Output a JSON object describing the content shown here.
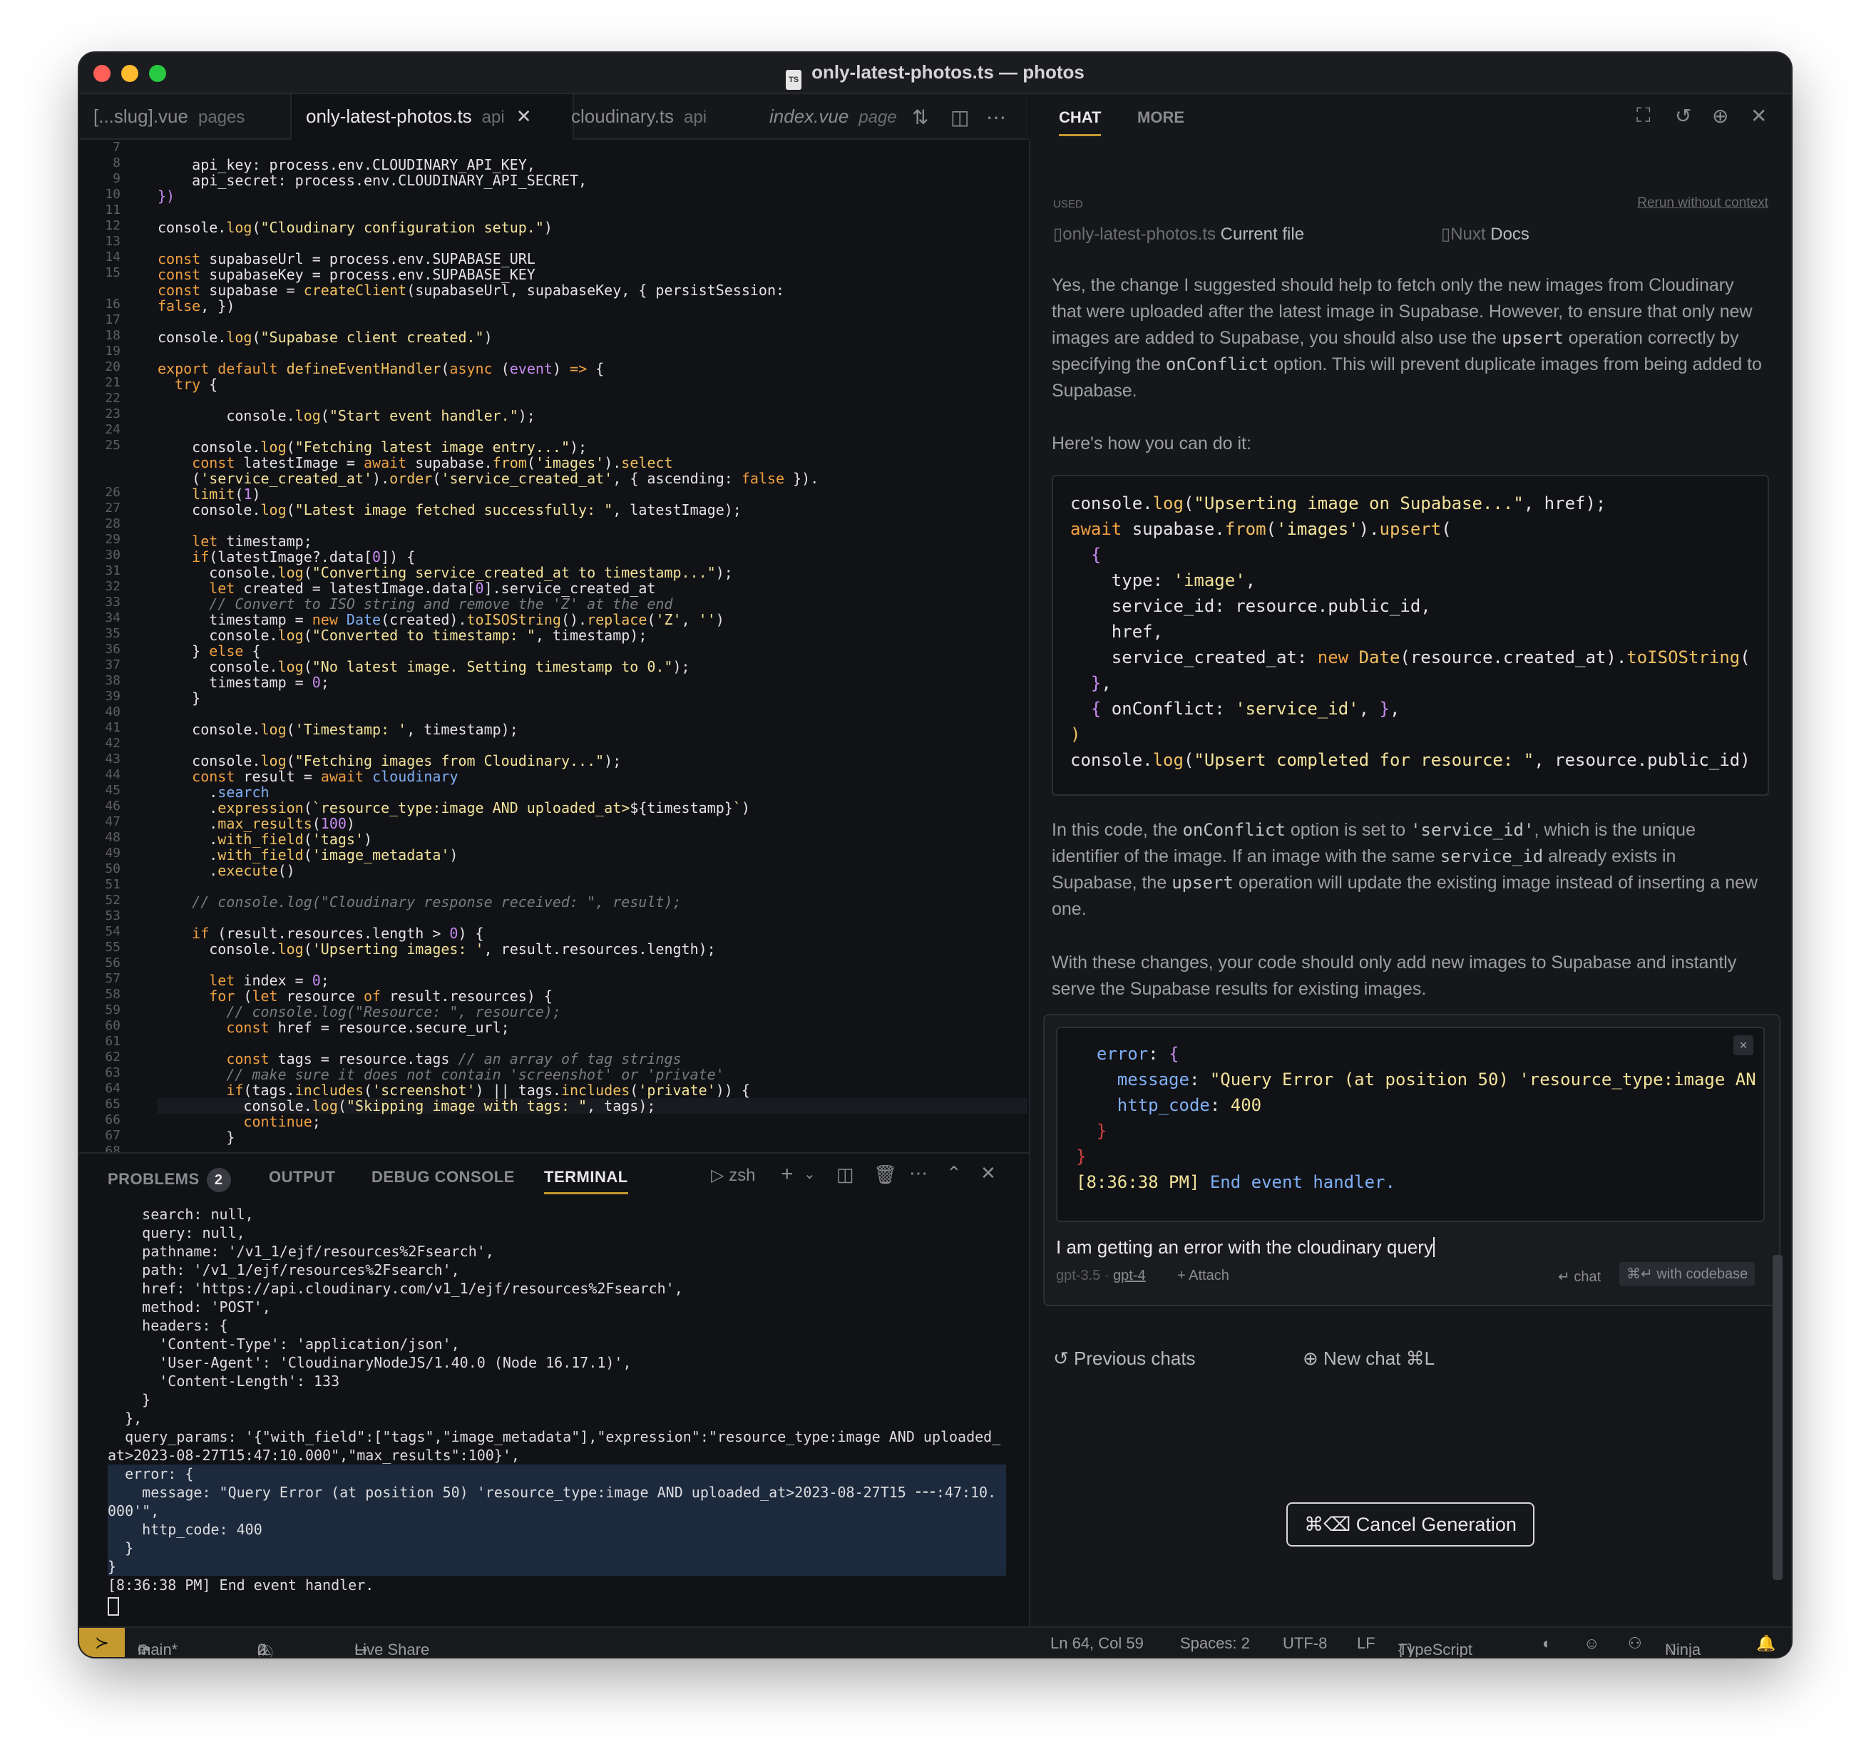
{
  "window": {
    "title": "only-latest-photos.ts — photos",
    "file_badge": "TS"
  },
  "tabs": [
    {
      "name": "[...slug].vue",
      "dir": "pages"
    },
    {
      "name": "only-latest-photos.ts",
      "dir": "api",
      "close": "✕"
    },
    {
      "name": "cloudinary.ts",
      "dir": "api"
    },
    {
      "name": "index.vue",
      "dir": "page"
    }
  ],
  "editor": {
    "line_numbers": [
      "7",
      "8",
      "9",
      "10",
      "11",
      "12",
      "13",
      "14",
      "15",
      "",
      "16",
      "17",
      "18",
      "19",
      "20",
      "21",
      "22",
      "23",
      "24",
      "25",
      "",
      "",
      "26",
      "27",
      "28",
      "29",
      "30",
      "31",
      "32",
      "33",
      "34",
      "35",
      "36",
      "37",
      "38",
      "39",
      "40",
      "41",
      "42",
      "43",
      "44",
      "45",
      "46",
      "47",
      "48",
      "49",
      "50",
      "51",
      "52",
      "53",
      "54",
      "55",
      "56",
      "57",
      "58",
      "59",
      "60",
      "61",
      "62",
      "63",
      "64",
      "65",
      "66",
      "67",
      "68"
    ]
  },
  "panel": {
    "tabs": {
      "problems": "PROBLEMS",
      "problems_count": "2",
      "output": "OUTPUT",
      "debug": "DEBUG CONSOLE",
      "terminal": "TERMINAL"
    },
    "shell": "zsh",
    "terminal_lines": [
      "    search: null,",
      "    query: null,",
      "    pathname: '/v1_1/ejf/resources%2Fsearch',",
      "    path: '/v1_1/ejf/resources%2Fsearch',",
      "    href: 'https://api.cloudinary.com/v1_1/ejf/resources%2Fsearch',",
      "    method: 'POST',",
      "    headers: {",
      "      'Content-Type': 'application/json',",
      "      'User-Agent': 'CloudinaryNodeJS/1.40.0 (Node 16.17.1)',",
      "      'Content-Length': 133",
      "    }",
      "  },",
      "  query_params: '{\"with_field\":[\"tags\",\"image_metadata\"],\"expression\":\"resource_type:image AND uploaded_",
      "at>2023-08-27T15:47:10.000\",\"max_results\":100}',",
      "  error: {",
      "    message: \"Query Error (at position 50) 'resource_type:image AND uploaded_at>2023-08-27T15 ⁃⁃⁃:47:10.",
      "000'\",",
      "    http_code: 400",
      "  }",
      "}",
      "[8:36:38 PM] End event handler."
    ]
  },
  "statusbar": {
    "branch": "main*",
    "errors": "2",
    "warnings": "0",
    "live_share": "Live Share",
    "position": "Ln 64, Col 59",
    "spaces": "Spaces: 2",
    "encoding": "UTF-8",
    "eol": "LF",
    "language": "TypeScript",
    "ninja": "Ninja"
  },
  "chat": {
    "tab_chat": "CHAT",
    "tab_more": "MORE",
    "used_label": "USED",
    "rerun": "Rerun without context",
    "ctx_file": "only-latest-photos.ts",
    "ctx_file_tag": "Current file",
    "ctx_docs_src": "Nuxt",
    "ctx_docs_tag": "Docs",
    "para1": "Yes, the change I suggested should help to fetch only the new images from Cloudinary that were uploaded after the latest image in Supabase. However, to ensure that only new images are added to Supabase, you should also use the ",
    "para1_code1": "upsert",
    "para1_mid": " operation correctly by specifying the ",
    "para1_code2": "onConflict",
    "para1_end": " option. This will prevent duplicate images from being added to Supabase.",
    "para2": "Here's how you can do it:",
    "para3_a": "In this code, the ",
    "para3_code1": "onConflict",
    "para3_b": " option is set to ",
    "para3_code2": "'service_id'",
    "para3_c": ", which is the unique identifier of the image. If an image with the same ",
    "para3_code3": "service_id",
    "para3_d": " already exists in Supabase, the ",
    "para3_code4": "upsert",
    "para3_e": " operation will update the existing image instead of inserting a new one.",
    "para4": "With these changes, your code should only add new images to Supabase and instantly serve the Supabase results for existing images.",
    "input_text": "I am getting an error with the cloudinary query",
    "model_a": "gpt-3.5",
    "model_b": "gpt-4",
    "attach": "Attach",
    "send_chat": "chat",
    "send_codebase": "with codebase",
    "previous_chats": "Previous chats",
    "new_chat": "New chat ⌘L",
    "cancel": "⌘⌫ Cancel Generation"
  },
  "colors": {
    "accent": "#c4992d",
    "background": "#111216",
    "chat_bg": "#16171b"
  }
}
